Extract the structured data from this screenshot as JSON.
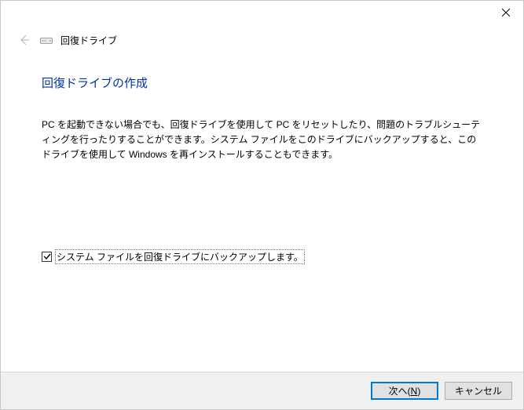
{
  "header": {
    "window_title": "回復ドライブ"
  },
  "page": {
    "title": "回復ドライブの作成",
    "description": "PC を起動できない場合でも、回復ドライブを使用して PC をリセットしたり、問題のトラブルシューティングを行ったりすることができます。システム ファイルをこのドライブにバックアップすると、このドライブを使用して Windows を再インストールすることもできます。"
  },
  "checkbox": {
    "label": "システム ファイルを回復ドライブにバックアップします。",
    "checked": true
  },
  "footer": {
    "next_prefix": "次へ(",
    "next_accesskey": "N",
    "next_suffix": ")",
    "cancel": "キャンセル"
  }
}
